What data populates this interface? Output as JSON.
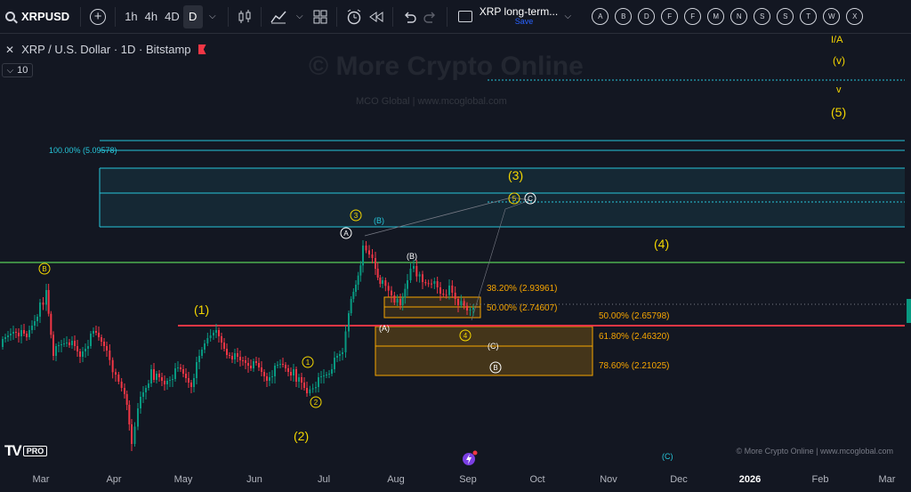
{
  "toolbar": {
    "symbol": "XRPUSD",
    "intervals": [
      "1h",
      "4h",
      "4D",
      "D"
    ],
    "active_interval": "D",
    "layout_name": "XRP long-term...",
    "layout_save": "Save",
    "letters": [
      "A",
      "B",
      "D",
      "F",
      "F",
      "M",
      "N",
      "S",
      "S",
      "T",
      "W",
      "X"
    ]
  },
  "legend": {
    "title": "XRP / U.S. Dollar · 1D · Bitstamp",
    "indicator_count": "10"
  },
  "watermark": {
    "main": "© More Crypto Online",
    "sub": "MCO Global   |   www.mcoglobal.com"
  },
  "copyright": "© More Crypto Online  |  www.mcoglobal.com",
  "branding": {
    "logo": "TV",
    "badge": "PRO"
  },
  "axis_months": [
    "Mar",
    "Apr",
    "May",
    "Jun",
    "Jul",
    "Aug",
    "Sep",
    "Oct",
    "Nov",
    "Dec",
    "2026",
    "Feb",
    "Mar"
  ],
  "fib_levels": {
    "top": "100.00% (5.09578)",
    "small_382": "38.20% (2.93961)",
    "small_50": "50.00% (2.74607)",
    "big_50": "50.00% (2.65798)",
    "big_618": "61.80% (2.46320)",
    "big_786": "78.60% (2.21025)"
  },
  "wave_labels": {
    "p1": "(1)",
    "p2": "(2)",
    "p3": "(3)",
    "p4": "(4)",
    "p5": "(5)",
    "v_top": "I/A",
    "v_paren": "(v)",
    "v_small": "v",
    "cB_left": "B",
    "c1": "1",
    "c2": "2",
    "c3": "3",
    "c4": "4",
    "c5": "5",
    "cA": "A",
    "cB": "B",
    "cC": "C",
    "cB_low": "B",
    "pB_blue": "(B)",
    "pB_white": "(B)",
    "pA": "(A)",
    "pC": "(C)",
    "pC_blue": "(C)"
  },
  "colors": {
    "background": "#131722",
    "up": "#089981",
    "down": "#f23645",
    "fib_box": "#26c6da",
    "fib_orange": "#f7a600",
    "green_line": "#4caf50",
    "red_line": "#f23645",
    "wave_yellow": "#f5d700"
  },
  "icons": [
    "search-icon",
    "add-symbol-icon",
    "chevron-down-icon",
    "candles-icon",
    "indicators-icon",
    "templates-icon",
    "alert-icon",
    "replay-icon",
    "undo-icon",
    "redo-icon",
    "layout-icon",
    "close-icon",
    "flag-icon",
    "flash-icon"
  ]
}
